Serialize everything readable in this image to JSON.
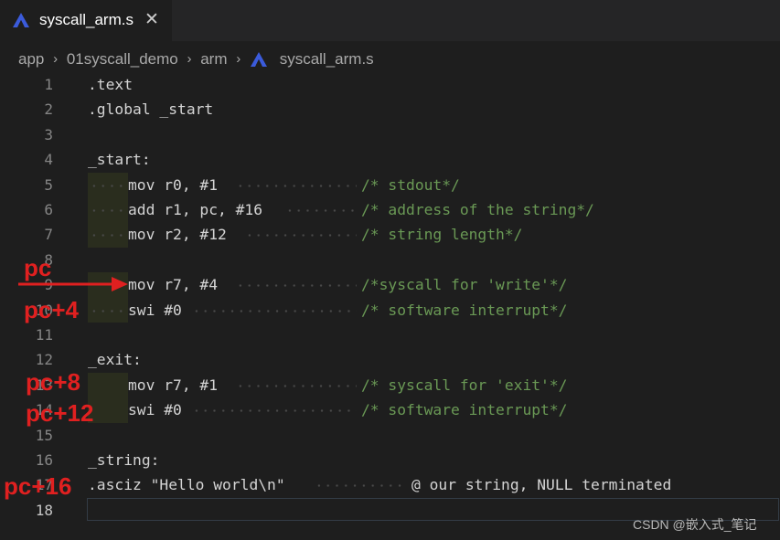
{
  "tab": {
    "title": "syscall_arm.s",
    "close_glyph": "✕",
    "icon": "arm-assembly-icon"
  },
  "breadcrumb": {
    "items": [
      "app",
      "01syscall_demo",
      "arm"
    ],
    "file": "syscall_arm.s",
    "separator": "›"
  },
  "lines": [
    {
      "n": "1",
      "code": ".text",
      "comment": ""
    },
    {
      "n": "2",
      "code": ".global _start",
      "comment": ""
    },
    {
      "n": "3",
      "code": "",
      "comment": ""
    },
    {
      "n": "4",
      "code": "_start:",
      "comment": ""
    },
    {
      "n": "5",
      "code": "mov r0, #1",
      "comment": "/* stdout*/"
    },
    {
      "n": "6",
      "code": "add r1, pc, #16",
      "comment": "/* address of the string*/"
    },
    {
      "n": "7",
      "code": "mov r2, #12",
      "comment": "/* string length*/"
    },
    {
      "n": "8",
      "code": "",
      "comment": ""
    },
    {
      "n": "9",
      "code": "mov r7, #4",
      "comment": "/*syscall for 'write'*/"
    },
    {
      "n": "10",
      "code": "swi #0",
      "comment": "/* software interrupt*/"
    },
    {
      "n": "11",
      "code": "",
      "comment": ""
    },
    {
      "n": "12",
      "code": "_exit:",
      "comment": ""
    },
    {
      "n": "13",
      "code": "mov r7, #1",
      "comment": "/* syscall for 'exit'*/"
    },
    {
      "n": "14",
      "code": "swi #0",
      "comment": "/* software interrupt*/"
    },
    {
      "n": "15",
      "code": "",
      "comment": ""
    },
    {
      "n": "16",
      "code": "_string:",
      "comment": ""
    },
    {
      "n": "17",
      "code": ".asciz \"Hello world\\n\"",
      "comment": "@ our string, NULL terminated"
    },
    {
      "n": "18",
      "code": "",
      "comment": ""
    }
  ],
  "annotations": {
    "pc": "pc",
    "pc4": "pc+4",
    "pc8": "pc+8",
    "pc12": "pc+12",
    "pc16": "pc+16"
  },
  "watermark": "CSDN @嵌入式_笔记",
  "colors": {
    "comment": "#6a9955",
    "annotation": "#e02020",
    "background": "#1e1e1e"
  }
}
